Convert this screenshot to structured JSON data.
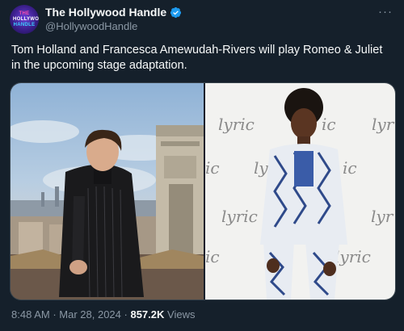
{
  "account": {
    "avatar_lines": [
      "THE",
      "HOLLYWOOD",
      "HANDLE"
    ],
    "name": "The Hollywood Handle",
    "handle": "@HollywoodHandle",
    "verified_icon": "verified-badge-icon",
    "more_icon": "more-dots-icon",
    "more_glyph": "···"
  },
  "tweet": {
    "text": "Tom Holland and Francesca Amewudah-Rivers will play Romeo & Juliet in the upcoming stage adaptation."
  },
  "media": {
    "backdrop_word": "lyric",
    "backdrop_partials": [
      "ic",
      "lyr",
      "ic"
    ]
  },
  "meta": {
    "time": "8:48 AM",
    "date": "Mar 28, 2024",
    "views_count": "857.2K",
    "views_label": "Views"
  },
  "colors": {
    "background": "#15202b",
    "text_primary": "#f7f9f9",
    "text_secondary": "#8b98a5",
    "verified": "#1d9bf0"
  }
}
